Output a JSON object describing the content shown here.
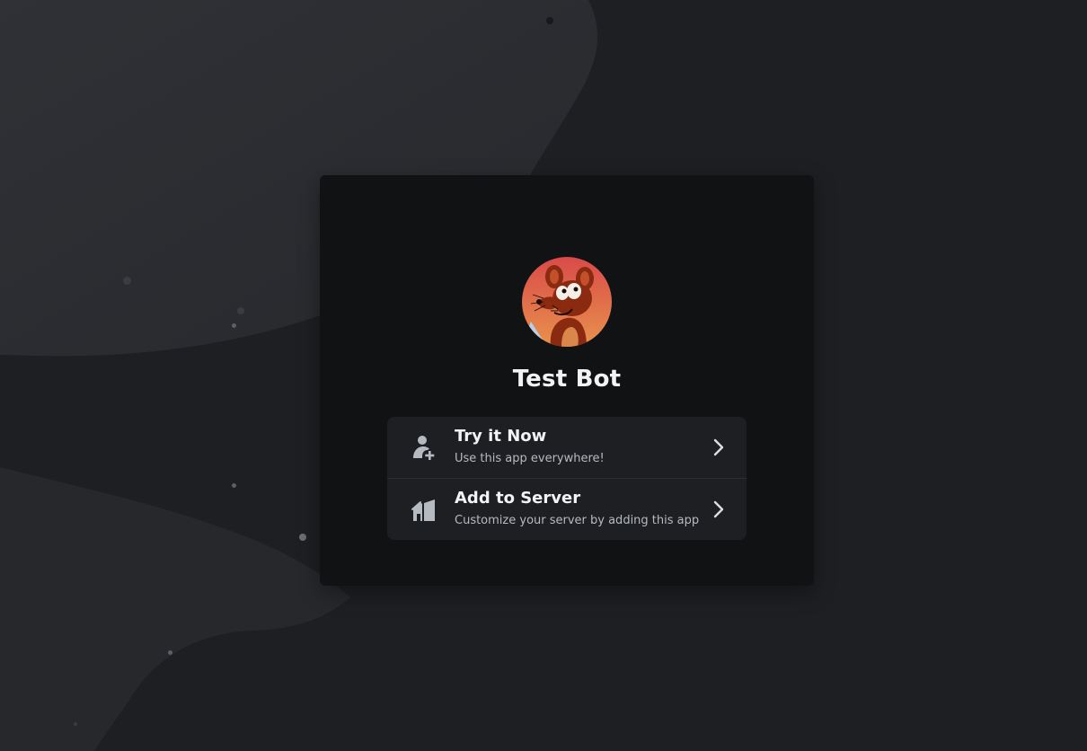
{
  "app": {
    "name": "Test Bot",
    "avatar_icon": "mouse-cartoon-avatar"
  },
  "options": [
    {
      "title": "Try it Now",
      "subtitle": "Use this app everywhere!",
      "icon": "user-plus-icon"
    },
    {
      "title": "Add to Server",
      "subtitle": "Customize your server by adding this app",
      "icon": "server-add-icon"
    }
  ],
  "colors": {
    "background": "#1e1f22",
    "background_wave": "#2b2d31",
    "card": "#111214",
    "options_panel": "#1e1f22",
    "text_primary": "#f2f3f5",
    "text_secondary": "#b5bac1"
  }
}
